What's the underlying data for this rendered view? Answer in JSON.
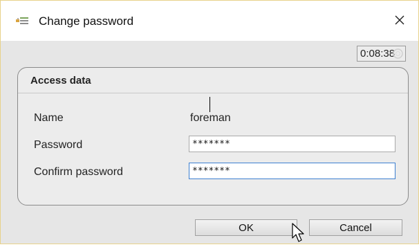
{
  "window": {
    "title": "Change password",
    "title_icon": "key-settings-icon",
    "close_icon": "close-icon"
  },
  "timer": {
    "value": "0:08:38",
    "icon": "clock-icon"
  },
  "access_data": {
    "title": "Access data",
    "name_label": "Name",
    "name_value": "foreman",
    "password_label": "Password",
    "password_value": "*******",
    "confirm_label": "Confirm password",
    "confirm_value": "*******"
  },
  "buttons": {
    "ok_label": "OK",
    "cancel_label": "Cancel"
  },
  "colors": {
    "focus_border": "#3c7fd0",
    "window_border": "#e8d28a"
  }
}
